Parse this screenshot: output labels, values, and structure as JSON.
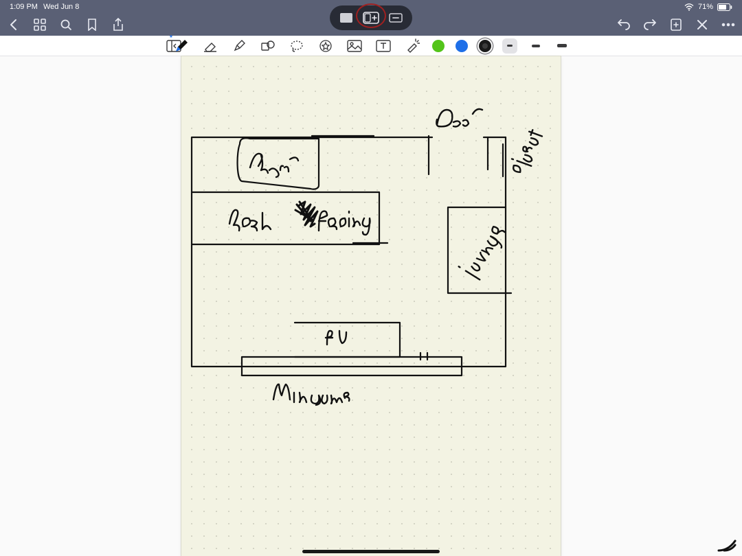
{
  "status": {
    "time": "1:09 PM",
    "date": "Wed Jun 8",
    "battery": "71%",
    "wifi_icon": "wifi"
  },
  "multitask": {
    "full_icon": "fullscreen",
    "split_icon": "split-plus",
    "slide_icon": "slideover"
  },
  "nav": {
    "back_icon": "chevron-left",
    "thumbnails_icon": "grid",
    "search_icon": "magnifier",
    "bookmark_icon": "bookmark",
    "share_icon": "share",
    "undo_icon": "undo",
    "redo_icon": "redo",
    "add_icon": "plus-page",
    "close_icon": "x",
    "more_icon": "ellipsis"
  },
  "toolbar": {
    "sidebar_icon": "sidebar-collapse",
    "pen_icon": "pen",
    "pen_bluetooth": "*",
    "eraser_icon": "eraser",
    "highlighter_icon": "marker",
    "shape_icon": "shape",
    "lasso_icon": "lasso",
    "sticker_icon": "star-badge",
    "image_icon": "photo",
    "text_icon": "textbox",
    "laser_icon": "wand",
    "colors": {
      "green": "#53c41a",
      "blue": "#1e6fe8",
      "black": "#1a1a1a",
      "selected_index": 2
    },
    "thickness": {
      "small": 8,
      "medium": 14,
      "large": 18,
      "selected": "small"
    }
  },
  "sketch_labels": {
    "chair": "Chair",
    "desk": "desk",
    "facing": "facing",
    "tv": "tv",
    "windows": "Windows",
    "door": "Door",
    "closet": "closet",
    "lounge": "lounge"
  },
  "device": {
    "home_indicator": true
  }
}
